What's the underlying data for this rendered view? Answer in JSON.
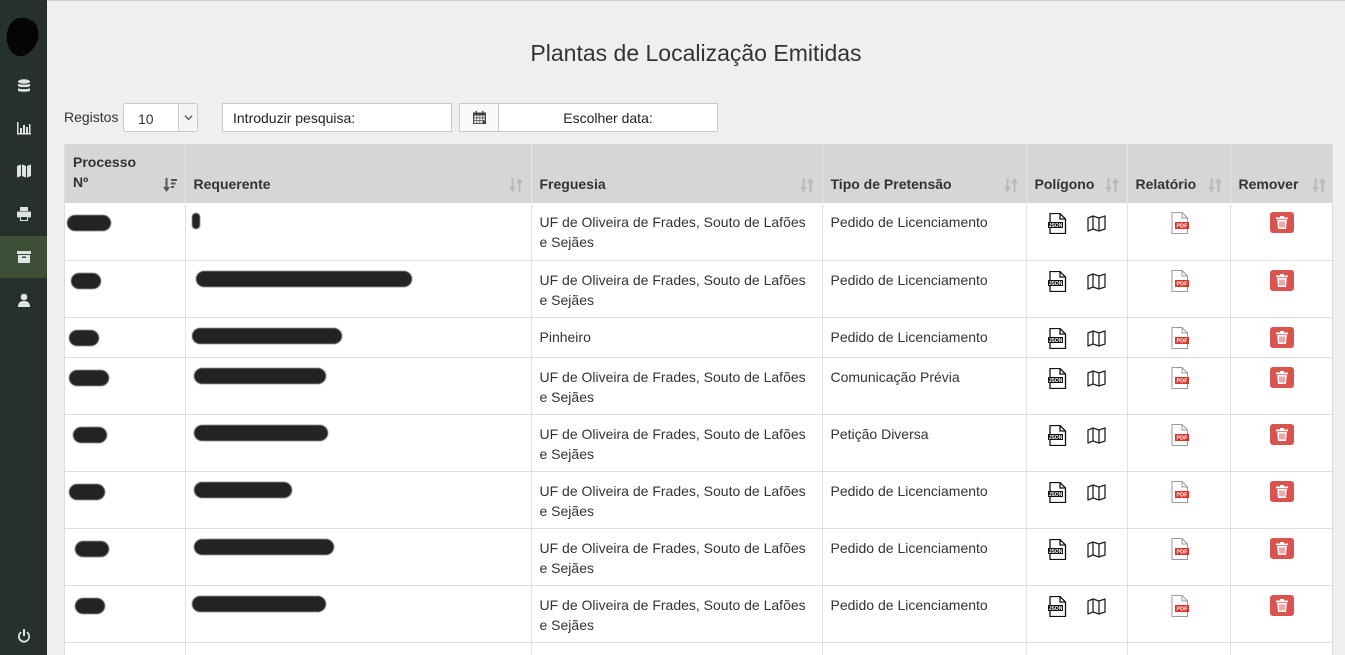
{
  "sidebar": {
    "items": [
      {
        "icon": "database-icon",
        "label": "Dados"
      },
      {
        "icon": "chart-icon",
        "label": "Estatísticas"
      },
      {
        "icon": "map-icon",
        "label": "Mapa"
      },
      {
        "icon": "print-icon",
        "label": "Imprimir"
      },
      {
        "icon": "archive-icon",
        "label": "Arquivo"
      },
      {
        "icon": "user-icon",
        "label": "Utilizador"
      },
      {
        "icon": "power-icon",
        "label": "Sair"
      }
    ],
    "active_index": 4
  },
  "page": {
    "title": "Plantas de Localização Emitidas"
  },
  "controls": {
    "registos_label": "Registos",
    "registos_value": "10",
    "search_placeholder": "Introduzir pesquisa:",
    "date_placeholder": "Escolher data:"
  },
  "table": {
    "headers": {
      "processo_line1": "Processo",
      "processo_line2": "Nº",
      "requerente": "Requerente",
      "freguesia": "Freguesia",
      "tipo": "Tipo de Pretensão",
      "poligono": "Polígono",
      "relatorio": "Relatório",
      "remover": "Remover"
    },
    "rows": [
      {
        "freguesia_1": "UF de Oliveira de Frades, Souto de Lafões",
        "freguesia_2": "e Sejães",
        "tipo": "Pedido de Licenciamento"
      },
      {
        "freguesia_1": "UF de Oliveira de Frades, Souto de Lafões",
        "freguesia_2": "e Sejães",
        "tipo": "Pedido de Licenciamento"
      },
      {
        "freguesia_1": "Pinheiro",
        "freguesia_2": "",
        "tipo": "Pedido de Licenciamento"
      },
      {
        "freguesia_1": "UF de Oliveira de Frades, Souto de Lafões",
        "freguesia_2": "e Sejães",
        "tipo": "Comunicação Prévia"
      },
      {
        "freguesia_1": "UF de Oliveira de Frades, Souto de Lafões",
        "freguesia_2": "e Sejães",
        "tipo": "Petição Diversa"
      },
      {
        "freguesia_1": "UF de Oliveira de Frades, Souto de Lafões",
        "freguesia_2": "e Sejães",
        "tipo": "Pedido de Licenciamento"
      },
      {
        "freguesia_1": "UF de Oliveira de Frades, Souto de Lafões",
        "freguesia_2": "e Sejães",
        "tipo": "Pedido de Licenciamento"
      },
      {
        "freguesia_1": "UF de Oliveira de Frades, Souto de Lafões",
        "freguesia_2": "e Sejães",
        "tipo": "Pedido de Licenciamento"
      }
    ]
  },
  "colors": {
    "sidebar_bg": "#26312f",
    "sidebar_active": "#3e4f38",
    "header_bg": "#d6d6d6",
    "danger": "#d9534f",
    "pdf_red": "#d9342b"
  }
}
